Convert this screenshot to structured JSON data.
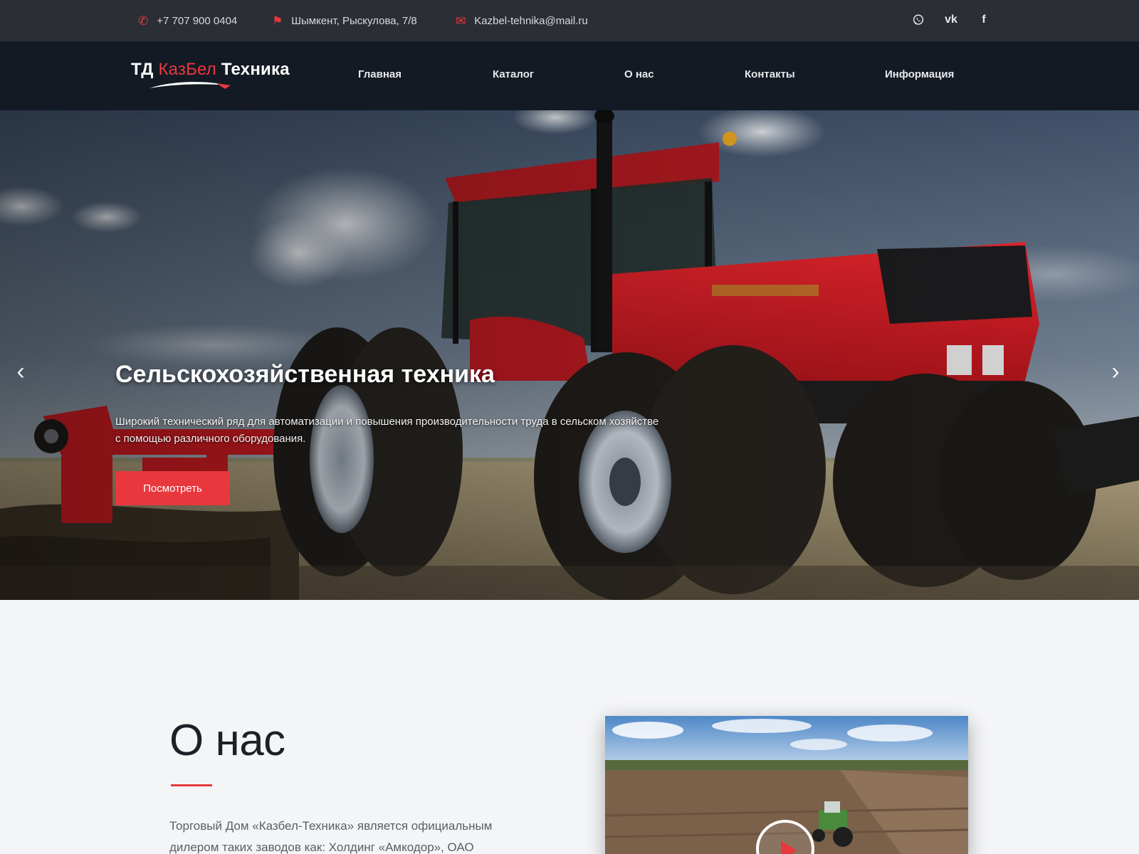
{
  "contacts": {
    "phone": "+7 707 900 0404",
    "address": "Шымкент, Рыскулова, 7/8",
    "email": "Kazbel-tehnika@mail.ru",
    "icons": {
      "phone": "phone-icon",
      "address": "map-icon",
      "email": "envelope-icon"
    }
  },
  "social": [
    {
      "name": "whatsapp-icon"
    },
    {
      "name": "vk-icon",
      "glyph": "vk"
    },
    {
      "name": "facebook-icon",
      "glyph": "f"
    }
  ],
  "logo": {
    "prefix": "ТД",
    "brand": "КазБел",
    "suffix": "Техника"
  },
  "nav": {
    "items": [
      {
        "label": "Главная"
      },
      {
        "label": "Каталог"
      },
      {
        "label": "О нас"
      },
      {
        "label": "Контакты"
      },
      {
        "label": "Информация"
      }
    ]
  },
  "hero": {
    "title": "Сельскохозяйственная техника",
    "text": "Широкий технический ряд для автоматизации и повышения производительности труда в сельском хозяйстве с помощью различного оборудования.",
    "button": "Посмотреть",
    "arrows": {
      "prev": "‹",
      "next": "›"
    }
  },
  "about": {
    "title": "О нас",
    "text": "Торговый Дом «Казбел-Техника» является официальным дилером таких заводов как: Холдинг «Амкодор», ОАО"
  },
  "colors": {
    "accent": "#e8383d",
    "topbar": "#2b2f35",
    "navbar": "#141a23",
    "page": "#f4f5f7"
  }
}
